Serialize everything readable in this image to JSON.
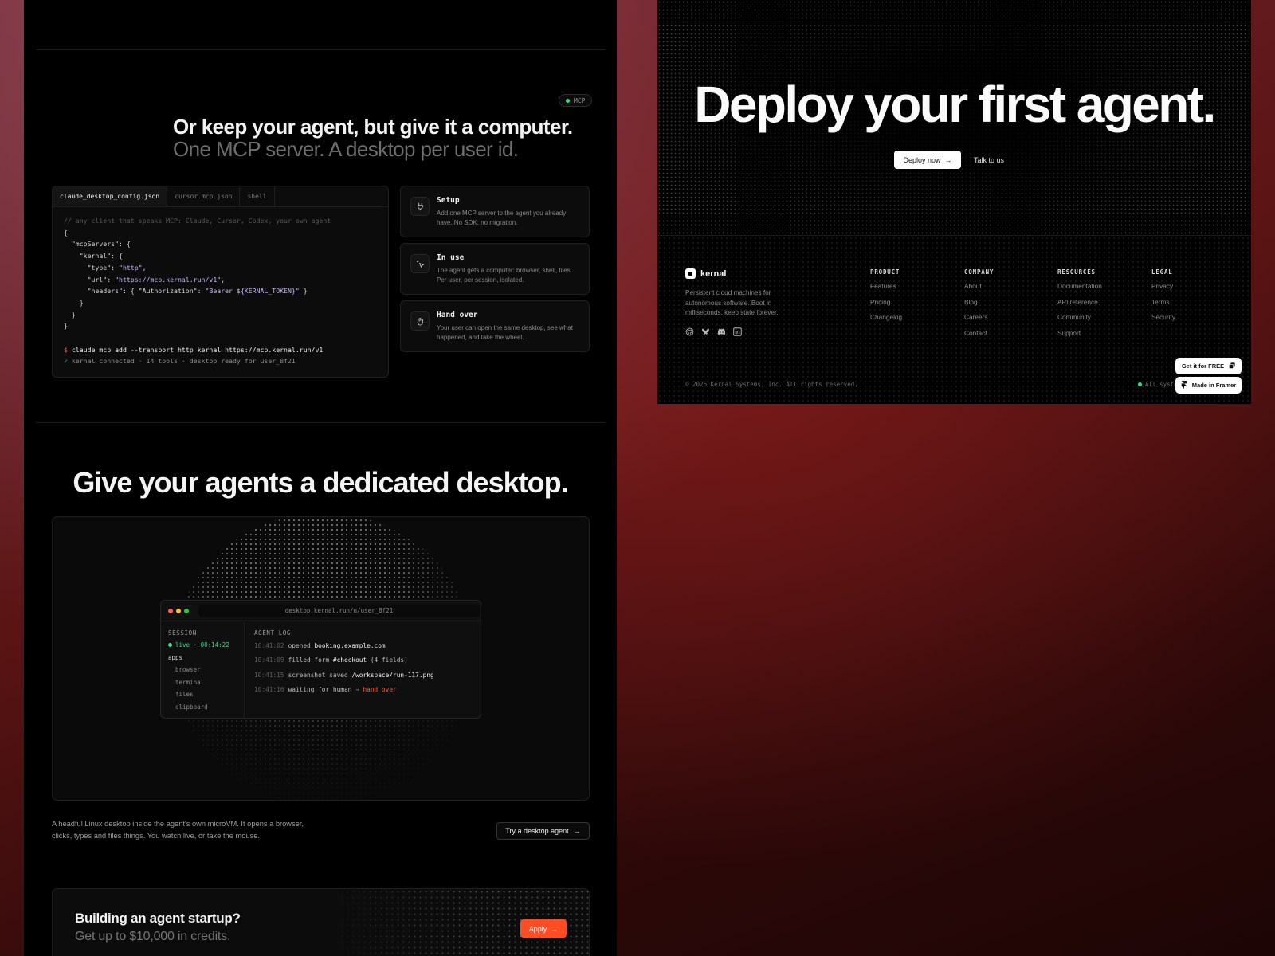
{
  "mcp_section": {
    "badge": "MCP",
    "title": "Or keep your agent, but give it a computer.",
    "subtitle": "One MCP server. A desktop per user id.",
    "tabs": [
      "claude_desktop_config.json",
      "cursor.mcp.json",
      "shell"
    ],
    "code": {
      "comment": "// any client that speaks MCP: Claude, Cursor, Codex, your own agent",
      "lines": [
        "{",
        "  \"mcpServers\": {",
        "    \"kernal\": {",
        "      \"type\": ",
        "      \"url\": ",
        "      \"headers\": { \"Authorization\": ",
        "    }",
        "  }",
        "}"
      ],
      "type_value": "\"http\"",
      "url_value": "\"https://mcp.kernal.run/v1\"",
      "auth_value": "\"Bearer ${KERNAL_TOKEN}\"",
      "prompt": "$",
      "command": "claude mcp add --transport http kernal https://mcp.kernal.run/v1",
      "check": "✓",
      "result": "kernal connected · 14 tools · desktop ready for user_8f21"
    },
    "steps": [
      {
        "icon": "plug-icon",
        "title": "Setup",
        "desc": "Add one MCP server to the agent you already have. No SDK, no migration."
      },
      {
        "icon": "cursor-click-icon",
        "title": "In use",
        "desc": "The agent gets a computer: browser, shell, files. Per user, per session, isolated."
      },
      {
        "icon": "hand-icon",
        "title": "Hand over",
        "desc": "Your user can open the same desktop, see what happened, and take the wheel."
      }
    ]
  },
  "desktop_section": {
    "title": "Give your agents a dedicated desktop.",
    "window": {
      "url": "desktop.kernal.run/u/user_8f21",
      "session_label": "SESSION",
      "live_text": "live · 00:14:22",
      "apps_label": "apps",
      "apps": [
        "browser",
        "terminal",
        "files",
        "clipboard"
      ],
      "log_label": "AGENT LOG",
      "log": [
        {
          "time": "10:41:02",
          "action": "opened",
          "target": "booking.example.com",
          "extra": ""
        },
        {
          "time": "10:41:09",
          "action": "filled form",
          "target": "#checkout",
          "extra": "(4 fields)"
        },
        {
          "time": "10:41:15",
          "action": "screenshot saved",
          "target": "/workspace/run-117.png",
          "extra": ""
        },
        {
          "time": "10:41:16",
          "action": "waiting for human",
          "target": "",
          "extra": "→ hand over"
        }
      ]
    },
    "description": "A headful Linux desktop inside the agent's own microVM. It opens a browser, clicks, types and files things. You watch live, or take the mouse.",
    "cta": "Try a desktop agent"
  },
  "startup": {
    "title": "Building an agent startup?",
    "subtitle": "Get up to $10,000 in credits.",
    "cta": "Apply"
  },
  "hero": {
    "title": "Deploy your first agent.",
    "primary_cta": "Deploy now",
    "secondary_cta": "Talk to us"
  },
  "footer": {
    "brand": "kernal",
    "tagline": "Persistent cloud machines for autonomous software. Boot in milliseconds, keep state forever.",
    "socials": [
      "github-icon",
      "bluesky-icon",
      "discord-icon",
      "linkedin-icon"
    ],
    "columns": [
      {
        "heading": "PRODUCT",
        "links": [
          "Features",
          "Pricing",
          "Changelog"
        ]
      },
      {
        "heading": "COMPANY",
        "links": [
          "About",
          "Blog",
          "Careers",
          "Contact"
        ]
      },
      {
        "heading": "RESOURCES",
        "links": [
          "Documentation",
          "API reference",
          "Community",
          "Support"
        ]
      },
      {
        "heading": "LEGAL",
        "links": [
          "Privacy",
          "Terms",
          "Security"
        ]
      }
    ],
    "copyright": "© 2026 Kernal Systems, Inc. All rights reserved.",
    "status": "All syste",
    "get_free": "Get it for FREE",
    "made_in": "Made in Framer"
  },
  "colors": {
    "accent": "#ff4d23",
    "live_green": "#3ddc84",
    "string_purple": "#c9b8ff"
  }
}
